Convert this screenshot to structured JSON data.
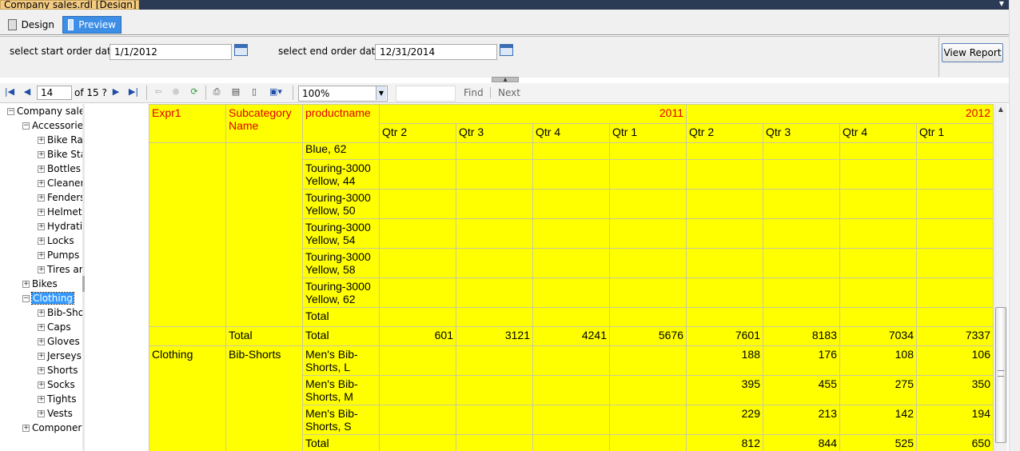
{
  "document_tab": {
    "title": "Company sales.rdl [Design]",
    "close": "✕"
  },
  "view_tabs": {
    "design": "Design",
    "preview": "Preview"
  },
  "parameters": {
    "start_label": "select start order date",
    "start_value": "1/1/2012",
    "end_label": "select end order date",
    "end_value": "12/31/2014",
    "view_report": "View Report"
  },
  "toolbar": {
    "page_current": "14",
    "page_of": "of  15 ?",
    "zoom": "100%",
    "find": "Find",
    "next": "Next",
    "icons": [
      "first-page-icon",
      "prev-page-icon",
      "next-page-icon",
      "last-page-icon",
      "back-icon",
      "stop-icon",
      "refresh-icon",
      "print-icon",
      "print-layout-icon",
      "page-setup-icon",
      "export-icon"
    ]
  },
  "doc_map": {
    "root": "Company sale",
    "accessories": "Accessorie",
    "accessories_children": [
      "Bike Ra",
      "Bike Sta",
      "Bottles",
      "Cleaner",
      "Fenders",
      "Helmet",
      "Hydrati",
      "Locks",
      "Pumps",
      "Tires ar"
    ],
    "bikes": "Bikes",
    "clothing": "Clothing",
    "clothing_children": [
      "Bib-Sho",
      "Caps",
      "Gloves",
      "Jerseys",
      "Shorts",
      "Socks",
      "Tights",
      "Vests"
    ],
    "components": "Componer"
  },
  "report": {
    "headers": {
      "expr1": "Expr1",
      "subcategory": "Subcategory Name",
      "productname": "productname",
      "year1": "2011",
      "year2": "2012"
    },
    "quarters": [
      "Qtr 2",
      "Qtr 3",
      "Qtr 4",
      "Qtr 1",
      "Qtr 2",
      "Qtr 3",
      "Qtr 4",
      "Qtr 1"
    ],
    "rows": [
      {
        "product": "Blue, 62",
        "values": [
          "",
          "",
          "",
          "",
          "",
          "",
          "",
          ""
        ]
      },
      {
        "product": "Touring-3000 Yellow, 44",
        "values": [
          "",
          "",
          "",
          "",
          "",
          "",
          "",
          ""
        ]
      },
      {
        "product": "Touring-3000 Yellow, 50",
        "values": [
          "",
          "",
          "",
          "",
          "",
          "",
          "",
          ""
        ]
      },
      {
        "product": "Touring-3000 Yellow, 54",
        "values": [
          "",
          "",
          "",
          "",
          "",
          "",
          "",
          ""
        ]
      },
      {
        "product": "Touring-3000 Yellow, 58",
        "values": [
          "",
          "",
          "",
          "",
          "",
          "",
          "",
          ""
        ]
      },
      {
        "product": "Touring-3000 Yellow, 62",
        "values": [
          "",
          "",
          "",
          "",
          "",
          "",
          "",
          ""
        ]
      },
      {
        "product": "Total",
        "values": [
          "",
          "",
          "",
          "",
          "",
          "",
          "",
          ""
        ]
      }
    ],
    "subtotal": {
      "subcategory": "Total",
      "product": "Total",
      "values": [
        "601",
        "3121",
        "4241",
        "5676",
        "7601",
        "8183",
        "7034",
        "7337"
      ]
    },
    "clothing": {
      "category": "Clothing",
      "subcategory": "Bib-Shorts",
      "rows": [
        {
          "product": "Men's Bib-Shorts, L",
          "values": [
            "",
            "",
            "",
            "",
            "188",
            "176",
            "108",
            "106"
          ]
        },
        {
          "product": "Men's Bib-Shorts, M",
          "values": [
            "",
            "",
            "",
            "",
            "395",
            "455",
            "275",
            "350"
          ]
        },
        {
          "product": "Men's Bib-Shorts, S",
          "values": [
            "",
            "",
            "",
            "",
            "229",
            "213",
            "142",
            "194"
          ]
        },
        {
          "product": "Total",
          "values": [
            "",
            "",
            "",
            "",
            "812",
            "844",
            "525",
            "650"
          ]
        }
      ]
    }
  }
}
